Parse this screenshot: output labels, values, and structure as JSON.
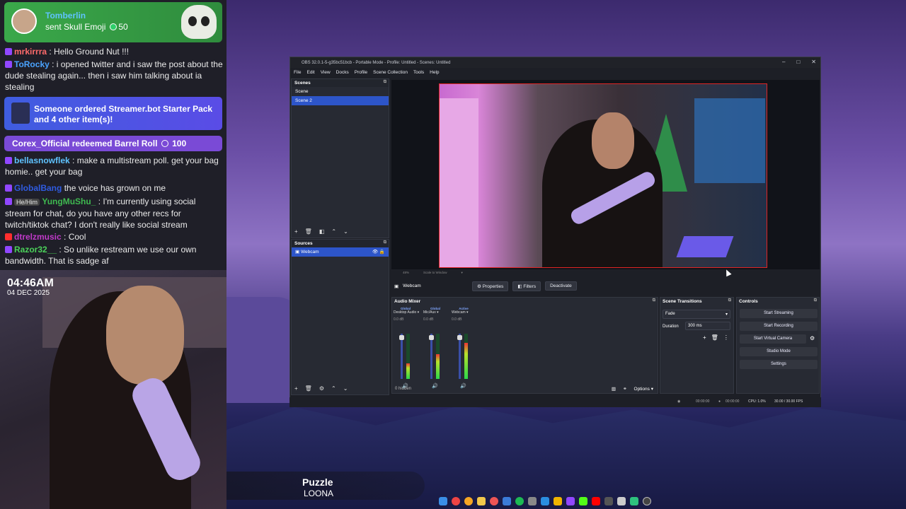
{
  "chat": {
    "gift": {
      "user": "Tomberlin",
      "message": "sent Skull Emoji",
      "amount": "50"
    },
    "messages": [
      {
        "user": "mrkirrra",
        "text": ": Hello Ground Nut !!!",
        "color": "#ff6b6b"
      },
      {
        "user": "ToRocky",
        "text": ": i opened twitter and i saw the post about the dude stealing again... then i saw him talking about ia stealing",
        "color": "#4aa3ff"
      },
      {
        "user": "bellasnowflek",
        "text": ": make a multistream poll. get your bag homie.. get your bag",
        "color": "#5fc3ff"
      },
      {
        "user": "GlobalBang",
        "text": "the voice has grown on me",
        "color": "#2f5be0"
      },
      {
        "user": "YungMuShu_",
        "pronoun": "He/Him",
        "text": ": I'm currently using social stream for chat, do you have any other recs for twitch/tiktok chat? I don't really like social stream",
        "color": "#3fb950"
      },
      {
        "user": "dtrelzmusic",
        "text": ": Cool",
        "color": "#c03ac9"
      },
      {
        "user": "Razor32__",
        "text": ": So unlike restream we use our own bandwidth. That is sadge af",
        "color": "#4bd25a"
      }
    ],
    "event_order": "Someone ordered Streamer.bot Starter Pack and 4 other item(s)!",
    "event_redeem": "Corex_Official redeemed Barrel Roll",
    "redeem_cost": "100"
  },
  "overlay": {
    "time": "04:46AM",
    "date": "04 DEC 2025"
  },
  "now_playing": {
    "title": "Puzzle",
    "artist": "LOONA"
  },
  "obs": {
    "title": "OBS 32.0.1-5-g35bc51bcb - Portable Mode - Profile: Untitled - Scenes: Untitled",
    "menu": [
      "File",
      "Edit",
      "View",
      "Docks",
      "Profile",
      "Scene Collection",
      "Tools",
      "Help"
    ],
    "scenes_label": "Scenes",
    "scenes": [
      "Scene",
      "Scene 2"
    ],
    "selected_scene": "Scene 2",
    "sources_label": "Sources",
    "sources": [
      "Webcam"
    ],
    "zoom": "48%",
    "scale": "Scale to Window",
    "source_bar": {
      "name": "Webcam",
      "properties": "Properties",
      "filters": "Filters",
      "deactivate": "Deactivate"
    },
    "mixer": {
      "label": "Audio Mixer",
      "channels": [
        {
          "tag": "Global",
          "name": "Desktop Audio",
          "db": "0.0 dB",
          "level": 0.35
        },
        {
          "tag": "Global",
          "name": "Mic/Aux",
          "db": "0.0 dB",
          "level": 0.55
        },
        {
          "tag": "Active",
          "name": "Webcam",
          "db": "0.0 dB",
          "level": 0.8
        }
      ],
      "hidden": "0 hidden",
      "options": "Options"
    },
    "transitions": {
      "label": "Scene Transitions",
      "type": "Fade",
      "duration_label": "Duration",
      "duration": "300 ms"
    },
    "controls": {
      "label": "Controls",
      "buttons": [
        "Start Streaming",
        "Start Recording",
        "Start Virtual Camera",
        "Studio Mode",
        "Settings"
      ]
    },
    "status": {
      "stream_time": "00:00:00",
      "rec_time": "00:00:00",
      "cpu": "CPU: 1.0%",
      "fps": "30.00 / 30.00 FPS"
    }
  }
}
